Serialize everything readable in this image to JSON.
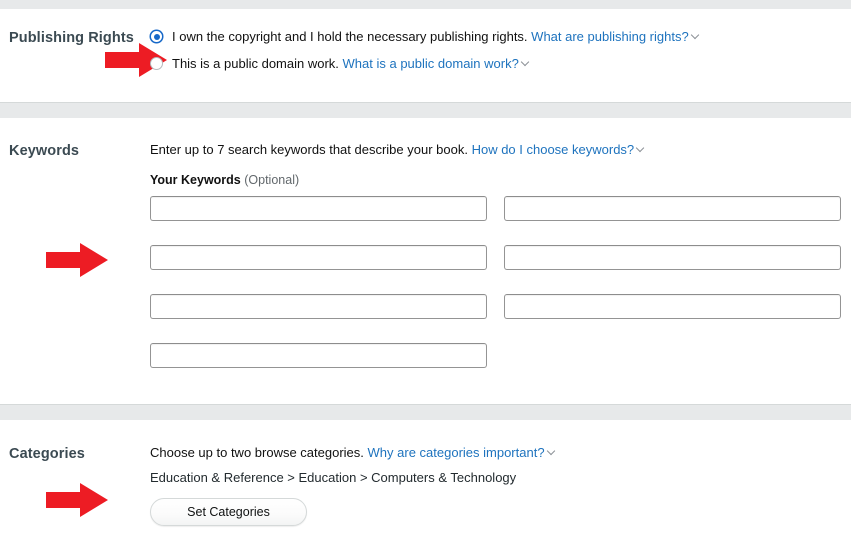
{
  "sections": {
    "publishing_rights": {
      "title": "Publishing Rights",
      "options": [
        {
          "text": "I own the copyright and I hold the necessary publishing rights.",
          "link": "What are publishing rights?",
          "selected": true
        },
        {
          "text": "This is a public domain work.",
          "link": "What is a public domain work?",
          "selected": false
        }
      ]
    },
    "keywords": {
      "title": "Keywords",
      "intro": "Enter up to 7 search keywords that describe your book.",
      "intro_link": "How do I choose keywords?",
      "sublabel": "Your Keywords",
      "sublabel_optional": "(Optional)",
      "fields": [
        {
          "value": "",
          "placeholder": ""
        },
        {
          "value": "",
          "placeholder": ""
        },
        {
          "value": "",
          "placeholder": ""
        },
        {
          "value": "",
          "placeholder": ""
        },
        {
          "value": "",
          "placeholder": ""
        },
        {
          "value": "",
          "placeholder": ""
        },
        {
          "value": "",
          "placeholder": ""
        }
      ]
    },
    "categories": {
      "title": "Categories",
      "intro": "Choose up to two browse categories.",
      "intro_link": "Why are categories important?",
      "selected_path": "Education & Reference > Education > Computers & Technology",
      "button_label": "Set Categories"
    }
  },
  "annotations": {
    "arrows": [
      {
        "name": "arrow-publishing-rights",
        "color": "#ed1c24"
      },
      {
        "name": "arrow-keywords",
        "color": "#ed1c24"
      },
      {
        "name": "arrow-categories",
        "color": "#ed1c24"
      }
    ]
  },
  "colors": {
    "link": "#1e73be",
    "section_title": "#3b4a52",
    "divider": "#e7e9ea",
    "arrow_red": "#ed1c24",
    "radio_selected": "#1768c8"
  }
}
